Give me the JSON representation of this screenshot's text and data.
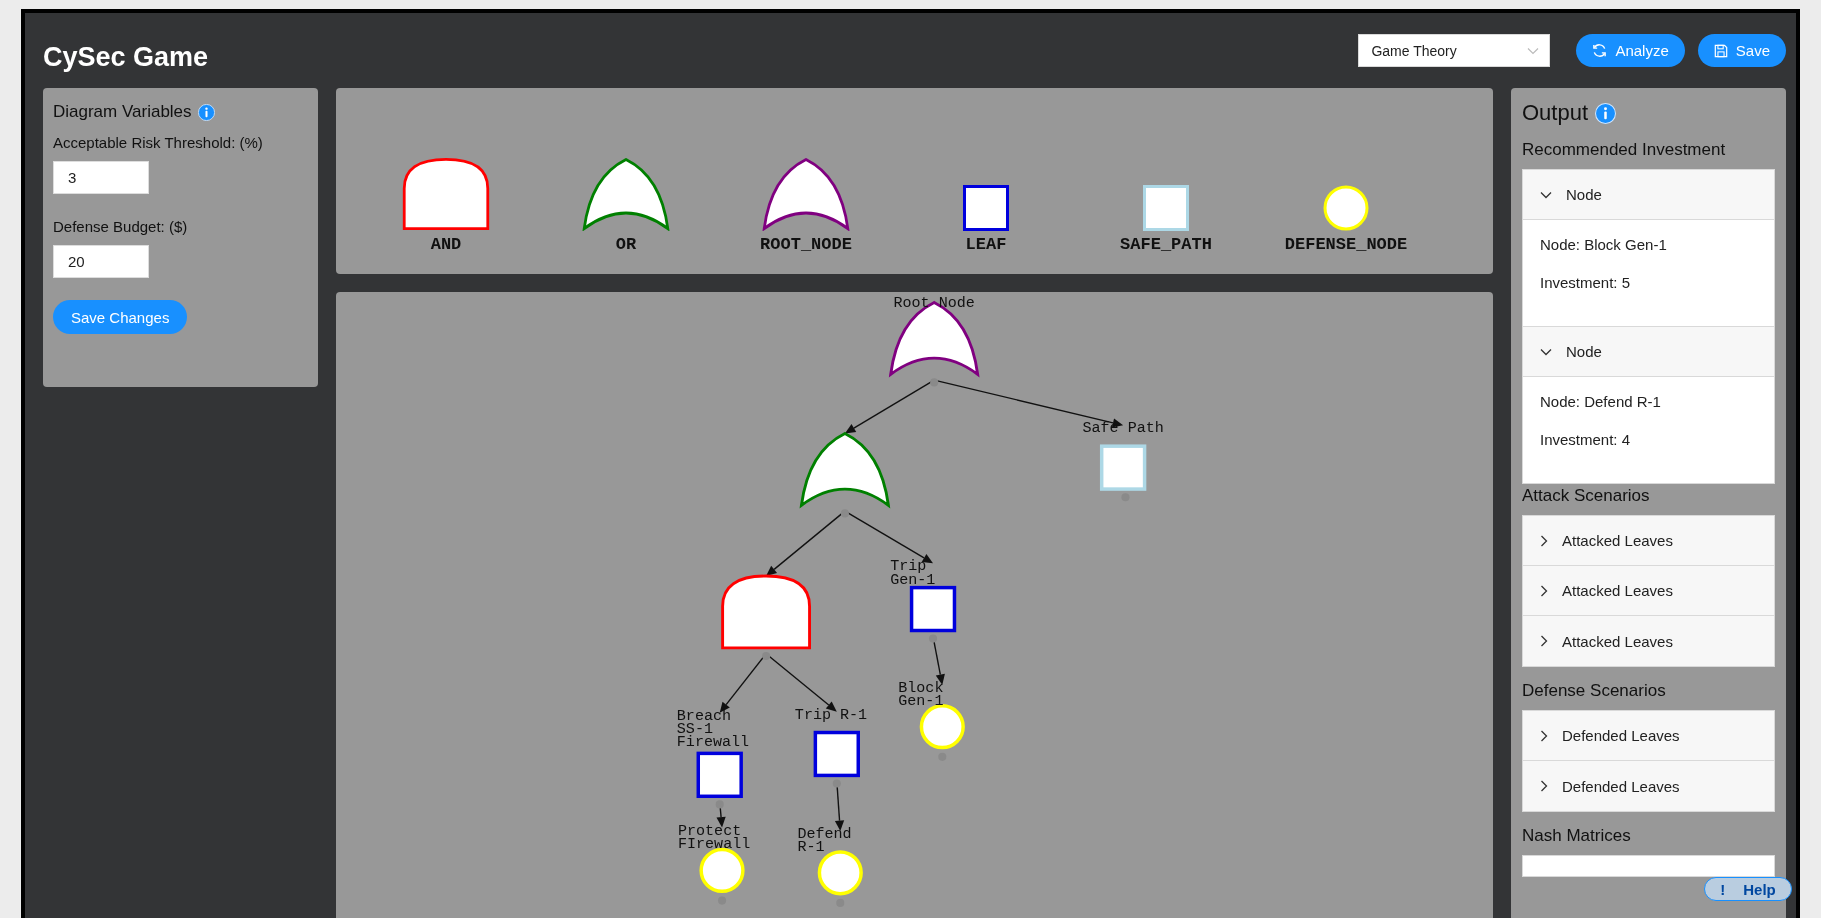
{
  "header": {
    "title": "CySec Game",
    "mode_dropdown": {
      "value": "Game Theory"
    },
    "buttons": [
      {
        "kind": "analyze",
        "label": "Analyze"
      },
      {
        "kind": "save",
        "label": "Save"
      }
    ]
  },
  "variables_panel": {
    "title": "Diagram Variables",
    "fields": [
      {
        "label": "Acceptable Risk Threshold: (%)",
        "value": "3"
      },
      {
        "label": "Defense Budget: ($)",
        "value": "20"
      }
    ],
    "save_button": "Save Changes"
  },
  "legend": [
    {
      "kind": "and",
      "label": "AND"
    },
    {
      "kind": "or",
      "label": "OR"
    },
    {
      "kind": "root",
      "label": "ROOT_NODE"
    },
    {
      "kind": "leaf",
      "label": "LEAF"
    },
    {
      "kind": "safe_path",
      "label": "SAFE_PATH"
    },
    {
      "kind": "defense",
      "label": "DEFENSE_NODE"
    }
  ],
  "diagram": {
    "root": {
      "kind": "root",
      "label": [
        "Root Node"
      ],
      "children": [
        {
          "kind": "or",
          "children": [
            {
              "kind": "and",
              "children": [
                {
                  "kind": "leaf",
                  "label": [
                    "Breach",
                    "SS-1",
                    "Firewall"
                  ],
                  "children": [
                    {
                      "kind": "defense",
                      "label": [
                        "Protect",
                        "FIrewall"
                      ]
                    }
                  ]
                },
                {
                  "kind": "leaf",
                  "label": [
                    "Trip R-1"
                  ],
                  "children": [
                    {
                      "kind": "defense",
                      "label": [
                        "Defend",
                        "R-1"
                      ]
                    }
                  ]
                }
              ]
            },
            {
              "kind": "leaf",
              "label": [
                "Trip",
                "Gen-1"
              ],
              "children": [
                {
                  "kind": "defense",
                  "label": [
                    "Block",
                    "Gen-1"
                  ]
                }
              ]
            }
          ]
        },
        {
          "kind": "safe_path",
          "label": [
            "Safe Path"
          ]
        }
      ]
    }
  },
  "output": {
    "title": "Output",
    "sections": [
      {
        "title": "Recommended Investment",
        "items": [
          {
            "title": "Node",
            "expanded": true,
            "lines": [
              "Node: Block Gen-1",
              "Investment: 5"
            ]
          },
          {
            "title": "Node",
            "expanded": true,
            "lines": [
              "Node: Defend R-1",
              "Investment: 4"
            ]
          }
        ]
      },
      {
        "title": "Attack Scenarios",
        "items": [
          {
            "title": "Attacked Leaves",
            "expanded": false
          },
          {
            "title": "Attacked Leaves",
            "expanded": false
          },
          {
            "title": "Attacked Leaves",
            "expanded": false
          }
        ]
      },
      {
        "title": "Defense Scenarios",
        "items": [
          {
            "title": "Defended Leaves",
            "expanded": false
          },
          {
            "title": "Defended Leaves",
            "expanded": false
          }
        ]
      },
      {
        "title": "Nash Matrices"
      }
    ],
    "help_button": {
      "icon_text": "!",
      "label": "Help"
    }
  }
}
